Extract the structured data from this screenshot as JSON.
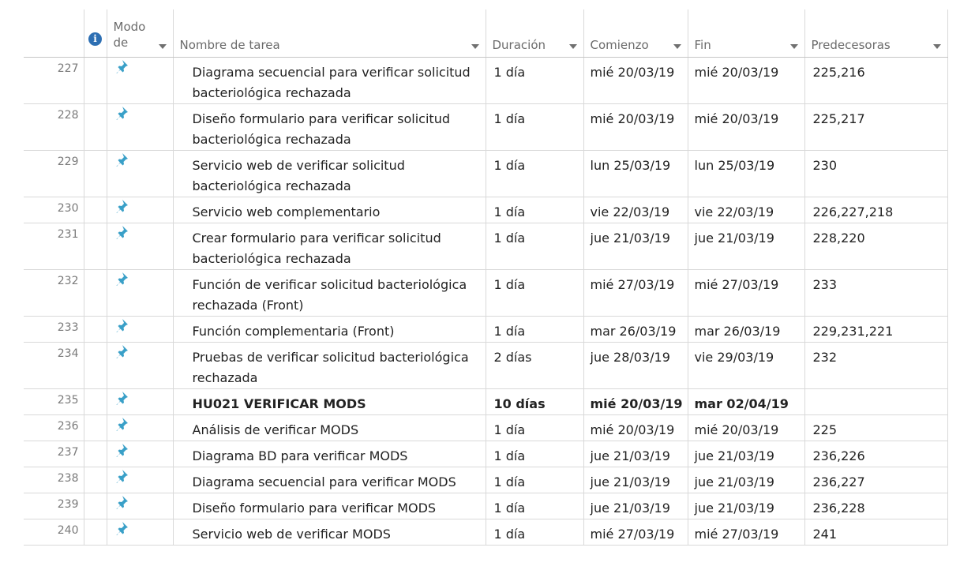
{
  "headers": {
    "info_icon": "i",
    "mode": "Modo de",
    "name": "Nombre de tarea",
    "duration": "Duración",
    "start": "Comienzo",
    "end": "Fin",
    "predecessors": "Predecesoras"
  },
  "colors": {
    "pin_icon": "#3aa0c8",
    "info_icon": "#2d6fb3",
    "grid_line": "#d9d9d9",
    "header_text": "#6b6b6b"
  },
  "rows": [
    {
      "id": "227",
      "name": "Diagrama secuencial para verificar solicitud bacteriológica rechazada",
      "duration": "1 día",
      "start": "mié 20/03/19",
      "end": "mié 20/03/19",
      "predecessors": "225,216",
      "bold": false
    },
    {
      "id": "228",
      "name": "Diseño formulario para verificar solicitud bacteriológica rechazada",
      "duration": "1 día",
      "start": "mié 20/03/19",
      "end": "mié 20/03/19",
      "predecessors": "225,217",
      "bold": false
    },
    {
      "id": "229",
      "name": "Servicio web de verificar solicitud bacteriológica rechazada",
      "duration": "1 día",
      "start": "lun 25/03/19",
      "end": "lun 25/03/19",
      "predecessors": "230",
      "bold": false
    },
    {
      "id": "230",
      "name": "Servicio web complementario",
      "duration": "1 día",
      "start": "vie 22/03/19",
      "end": "vie 22/03/19",
      "predecessors": "226,227,218",
      "bold": false
    },
    {
      "id": "231",
      "name": "Crear formulario para verificar solicitud bacteriológica rechazada",
      "duration": "1 día",
      "start": "jue 21/03/19",
      "end": "jue 21/03/19",
      "predecessors": "228,220",
      "bold": false
    },
    {
      "id": "232",
      "name": "Función de verificar solicitud bacteriológica rechazada (Front)",
      "duration": "1 día",
      "start": "mié 27/03/19",
      "end": "mié 27/03/19",
      "predecessors": "233",
      "bold": false
    },
    {
      "id": "233",
      "name": "Función complementaria (Front)",
      "duration": "1 día",
      "start": "mar 26/03/19",
      "end": "mar 26/03/19",
      "predecessors": "229,231,221",
      "bold": false
    },
    {
      "id": "234",
      "name": "Pruebas de verificar solicitud bacteriológica rechazada",
      "duration": "2 días",
      "start": "jue 28/03/19",
      "end": "vie 29/03/19",
      "predecessors": "232",
      "bold": false
    },
    {
      "id": "235",
      "name": "HU021 VERIFICAR MODS",
      "duration": "10 días",
      "start": "mié 20/03/19",
      "end": "mar 02/04/19",
      "predecessors": "",
      "bold": true
    },
    {
      "id": "236",
      "name": "Análisis de verificar MODS",
      "duration": "1 día",
      "start": "mié 20/03/19",
      "end": "mié 20/03/19",
      "predecessors": "225",
      "bold": false
    },
    {
      "id": "237",
      "name": "Diagrama BD para verificar MODS",
      "duration": "1 día",
      "start": "jue 21/03/19",
      "end": "jue 21/03/19",
      "predecessors": "236,226",
      "bold": false
    },
    {
      "id": "238",
      "name": "Diagrama secuencial para verificar MODS",
      "duration": "1 día",
      "start": "jue 21/03/19",
      "end": "jue 21/03/19",
      "predecessors": "236,227",
      "bold": false
    },
    {
      "id": "239",
      "name": "Diseño formulario para verificar MODS",
      "duration": "1 día",
      "start": "jue 21/03/19",
      "end": "jue 21/03/19",
      "predecessors": "236,228",
      "bold": false
    },
    {
      "id": "240",
      "name": "Servicio web de verificar MODS",
      "duration": "1 día",
      "start": "mié 27/03/19",
      "end": "mié 27/03/19",
      "predecessors": "241",
      "bold": false
    }
  ]
}
